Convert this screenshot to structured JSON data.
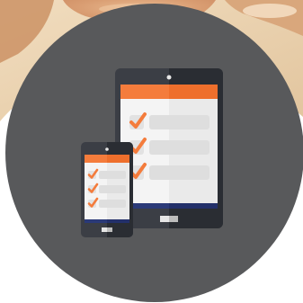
{
  "scene": {
    "background_photo": "blurred-person-photo",
    "circle_color": "#58595b",
    "accent_color": "#f47c3c",
    "screen_color": "#f5f5f5",
    "frame_dark": "#2a2d33",
    "frame_light": "#3a3d44",
    "bar_color": "#2b3a78"
  },
  "tablet": {
    "icon": "tablet-device-icon",
    "checklist": [
      {
        "icon": "checkmark-icon",
        "checked": true
      },
      {
        "icon": "checkmark-icon",
        "checked": true
      },
      {
        "icon": "checkmark-icon",
        "checked": true
      }
    ]
  },
  "phone": {
    "icon": "smartphone-device-icon",
    "checklist": [
      {
        "icon": "checkmark-icon",
        "checked": true
      },
      {
        "icon": "checkmark-icon",
        "checked": true
      },
      {
        "icon": "checkmark-icon",
        "checked": true
      }
    ]
  }
}
